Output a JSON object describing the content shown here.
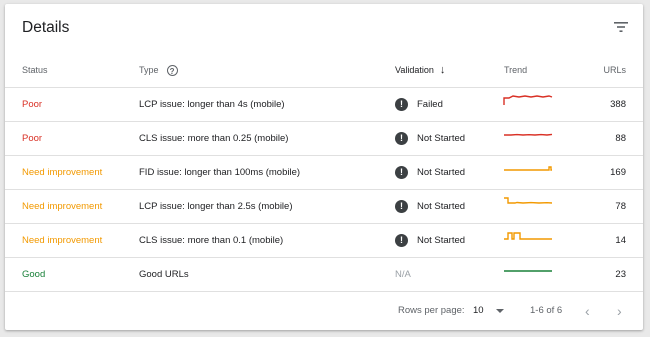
{
  "card": {
    "title": "Details",
    "filter_icon": "filter-list-icon"
  },
  "columns": {
    "status": "Status",
    "type": "Type",
    "type_help_icon": "help-circle-icon",
    "validation": "Validation",
    "validation_sort_icon": "arrow-down-icon",
    "trend": "Trend",
    "urls": "URLs"
  },
  "colors": {
    "poor": "#d93025",
    "need_improvement": "#f29900",
    "good": "#188038",
    "validation_icon": "#3c4043"
  },
  "rows": [
    {
      "status": "Poor",
      "status_kind": "poor",
      "type": "LCP issue: longer than 4s (mobile)",
      "validation": "Failed",
      "validation_icon": "exclamation-circle-icon",
      "urls": "388",
      "trend_color": "#d93025"
    },
    {
      "status": "Poor",
      "status_kind": "poor",
      "type": "CLS issue: more than 0.25 (mobile)",
      "validation": "Not Started",
      "validation_icon": "exclamation-circle-icon",
      "urls": "88",
      "trend_color": "#d93025"
    },
    {
      "status": "Need improvement",
      "status_kind": "need_improvement",
      "type": "FID issue: longer than 100ms (mobile)",
      "validation": "Not Started",
      "validation_icon": "exclamation-circle-icon",
      "urls": "169",
      "trend_color": "#f29900"
    },
    {
      "status": "Need improvement",
      "status_kind": "need_improvement",
      "type": "LCP issue: longer than 2.5s (mobile)",
      "validation": "Not Started",
      "validation_icon": "exclamation-circle-icon",
      "urls": "78",
      "trend_color": "#f29900"
    },
    {
      "status": "Need improvement",
      "status_kind": "need_improvement",
      "type": "CLS issue: more than 0.1 (mobile)",
      "validation": "Not Started",
      "validation_icon": "exclamation-circle-icon",
      "urls": "14",
      "trend_color": "#f29900"
    },
    {
      "status": "Good",
      "status_kind": "good",
      "type": "Good URLs",
      "validation": "N/A",
      "validation_icon": "",
      "urls": "23",
      "trend_color": "#188038"
    }
  ],
  "footer": {
    "rows_per_page_label": "Rows per page:",
    "rows_per_page_value": "10",
    "range": "1-6 of 6",
    "prev_icon": "chevron-left-icon",
    "next_icon": "chevron-right-icon"
  }
}
